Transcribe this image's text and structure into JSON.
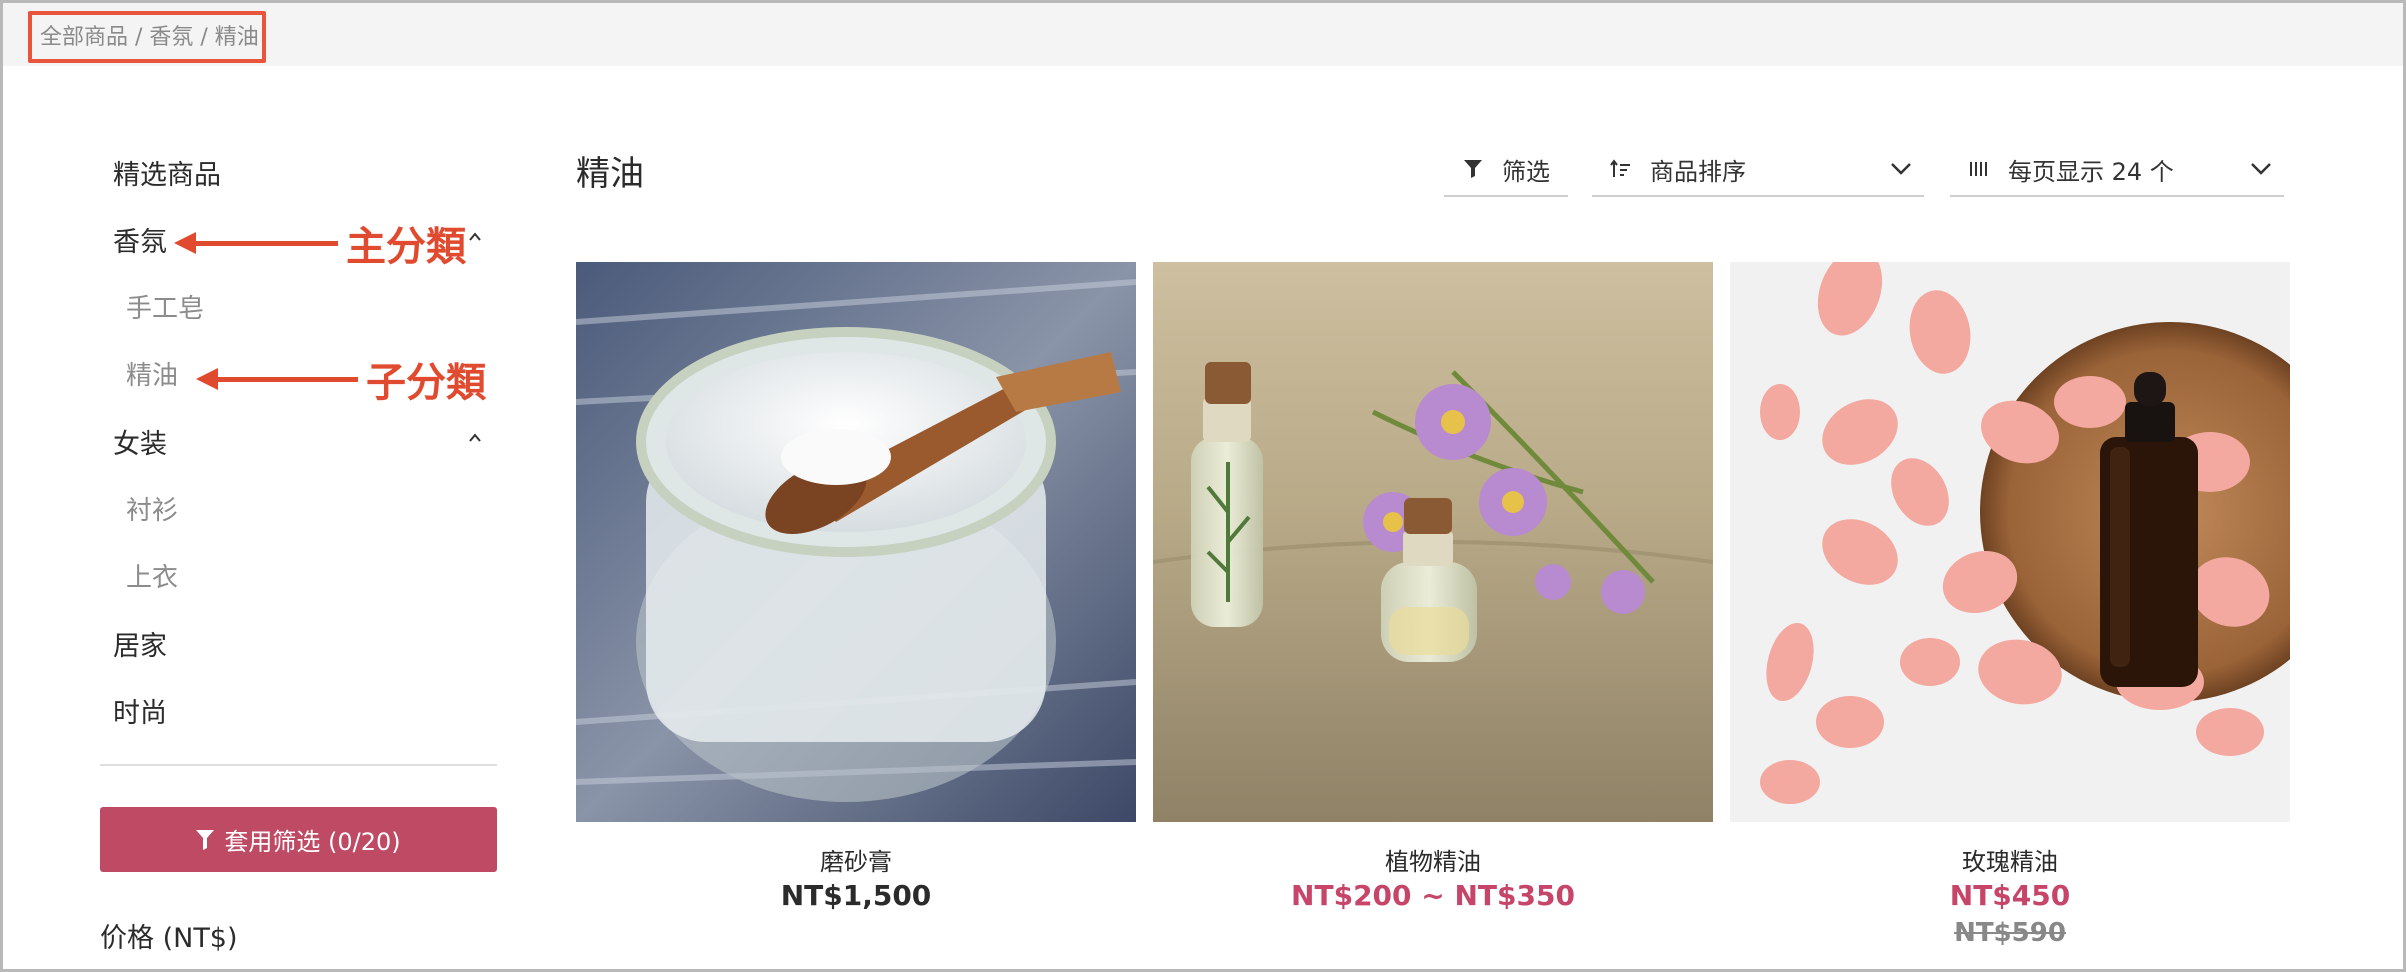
{
  "breadcrumb": "全部商品 / 香氛 / 精油",
  "sidebar": {
    "items": [
      {
        "label": "精选商品"
      },
      {
        "label": "香氛"
      },
      {
        "label": "手工皂"
      },
      {
        "label": "精油"
      },
      {
        "label": "女装"
      },
      {
        "label": "衬衫"
      },
      {
        "label": "上衣"
      },
      {
        "label": "居家"
      },
      {
        "label": "时尚"
      }
    ]
  },
  "annotations": {
    "main_category": "主分類",
    "sub_category": "子分類"
  },
  "filter": {
    "apply_label": "套用筛选 (0/20)",
    "price_heading": "价格 (NT$)"
  },
  "main": {
    "title": "精油",
    "toolbar": {
      "filter_label": "筛选",
      "sort_label": "商品排序",
      "per_page_label": "每页显示 24 个"
    }
  },
  "products": [
    {
      "name": "磨砂膏",
      "price": "NT$1,500",
      "old_price": ""
    },
    {
      "name": "植物精油",
      "price": "NT$200 ~ NT$350",
      "old_price": ""
    },
    {
      "name": "玫瑰精油",
      "price": "NT$450",
      "old_price": "NT$590"
    }
  ],
  "colors": {
    "accent": "#bf4a64",
    "annotation": "#e04a2f",
    "regular_price": "#2b2b2b",
    "sale_price": "#c8456a"
  }
}
